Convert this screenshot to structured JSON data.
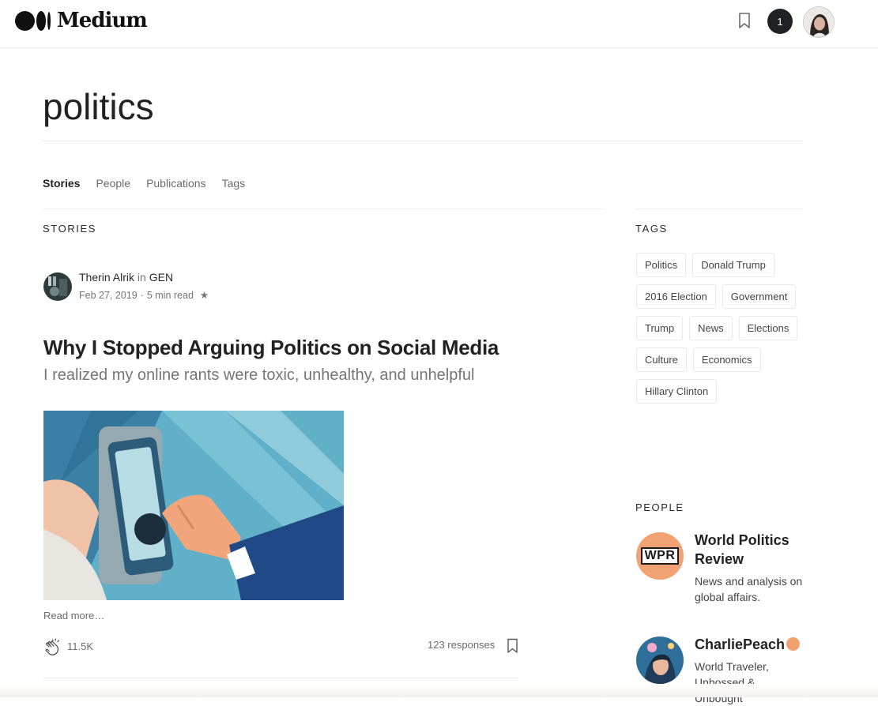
{
  "header": {
    "logo_text": "Medium",
    "notification_count": "1",
    "icons": [
      "bookmark-icon",
      "notification-badge",
      "avatar"
    ]
  },
  "page": {
    "title": "politics"
  },
  "tabs": [
    {
      "label": "Stories",
      "active": true
    },
    {
      "label": "People",
      "active": false
    },
    {
      "label": "Publications",
      "active": false
    },
    {
      "label": "Tags",
      "active": false
    }
  ],
  "stories_section": {
    "label": "STORIES",
    "story": {
      "author": "Therin Alrik",
      "in_word": "in",
      "publication": "GEN",
      "date": "Feb 27, 2019",
      "separator": "·",
      "read_time": "5 min read",
      "star": "★",
      "title": "Why I Stopped Arguing Politics on Social Media",
      "subtitle": "I realized my online rants were toxic, unhealthy, and unhelpful",
      "read_more": "Read more…",
      "claps": "11.5K",
      "responses": "123 responses"
    }
  },
  "tags_section": {
    "label": "TAGS",
    "tags": [
      "Politics",
      "Donald Trump",
      "2016 Election",
      "Government",
      "Trump",
      "News",
      "Elections",
      "Culture",
      "Economics",
      "Hillary Clinton"
    ]
  },
  "people_section": {
    "label": "PEOPLE",
    "people": [
      {
        "name": "World Politics Review",
        "bio": "News and analysis on global affairs.",
        "avatar_text": "WPR"
      },
      {
        "name": "CharliePeach",
        "bio": "World Traveler, Unbossed & Unbought"
      }
    ]
  },
  "colors": {
    "accent_orange": "#f3a276",
    "text_dark": "#222222",
    "text_muted": "#757575"
  }
}
